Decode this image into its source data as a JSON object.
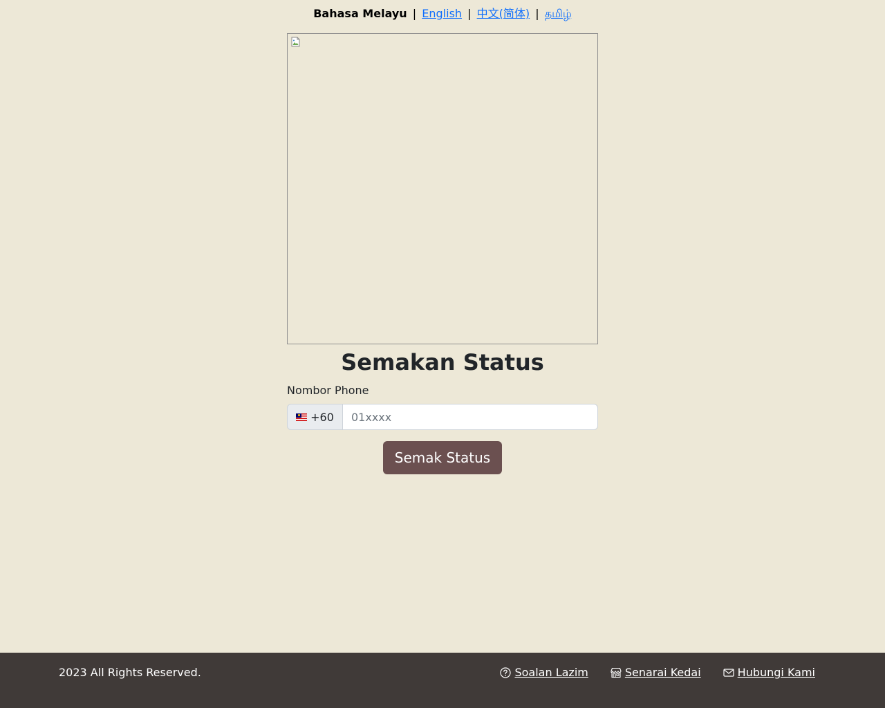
{
  "language_bar": {
    "current": "Bahasa Melayu",
    "separator": "|",
    "links": [
      {
        "label": "English"
      },
      {
        "label": "中文(简体)"
      },
      {
        "label": "தமிழ்"
      }
    ]
  },
  "banner": {
    "icon": "broken-image-icon"
  },
  "form": {
    "title": "Semakan Status",
    "phone_label": "Nombor Phone",
    "country_flag_icon": "malaysia-flag-icon",
    "country_code": "+60",
    "phone_placeholder": "01xxxx",
    "phone_value": "",
    "submit_label": "Semak Status"
  },
  "footer": {
    "copyright": "2023 All Rights Reserved.",
    "links": [
      {
        "label": "Soalan Lazim",
        "icon": "question-circle-icon"
      },
      {
        "label": "Senarai Kedai",
        "icon": "shop-icon"
      },
      {
        "label": "Hubungi Kami",
        "icon": "envelope-icon"
      }
    ]
  },
  "colors": {
    "background": "#ede8d7",
    "button": "#6b5050",
    "footer": "#403a38",
    "link": "#0d6efd"
  }
}
